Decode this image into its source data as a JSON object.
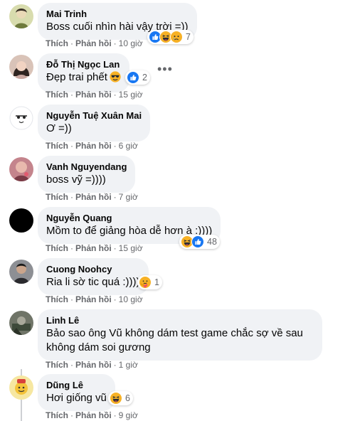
{
  "actions": {
    "like_label": "Thích",
    "reply_label": "Phản hồi",
    "separator": "·"
  },
  "more_options": "•••",
  "comments": [
    {
      "name": "Mai Trinh",
      "text": "Boss cuối nhìn hài vậy trời =))",
      "time": "10 giờ",
      "reaction_count": "7",
      "reactions": [
        "like-icon",
        "haha-icon",
        "sad-icon"
      ]
    },
    {
      "name": "Đỗ Thị Ngọc Lan",
      "text": "Đẹp trai phết",
      "emoji": "sunglasses-emoji",
      "time": "15 giờ",
      "reaction_count": "2",
      "reactions": [
        "like-icon"
      ]
    },
    {
      "name": "Nguyễn Tuệ Xuân Mai",
      "text": "Ơ =))",
      "time": "6 giờ"
    },
    {
      "name": "Vanh Nguyendang",
      "text": "boss vỹ =))))",
      "time": "7 giờ"
    },
    {
      "name": "Nguyễn Quang",
      "text": "Mồm to để giảng hòa dễ hơn à :))))",
      "time": "15 giờ",
      "reaction_count": "48",
      "reactions": [
        "haha-icon",
        "like-icon"
      ]
    },
    {
      "name": "Cuong Noohcy",
      "text": "Ria li sờ tic quá :))))",
      "time": "10 giờ",
      "reaction_count": "1",
      "reactions": [
        "care-icon"
      ]
    },
    {
      "name": "Linh Lê",
      "text": "Bảo sao ông Vũ không dám test game chắc sợ về sau không dám soi gương",
      "time": "1 giờ"
    },
    {
      "name": "Dũng Lê",
      "text": "Hơi giống vũ",
      "time": "9 giờ",
      "reaction_count": "6",
      "reactions": [
        "haha-icon"
      ]
    }
  ],
  "colors": {
    "bubble": "#f0f2f5",
    "name": "#050505",
    "meta": "#65676b",
    "like_blue": "#1877f2",
    "haha_yellow": "#f7b125"
  }
}
